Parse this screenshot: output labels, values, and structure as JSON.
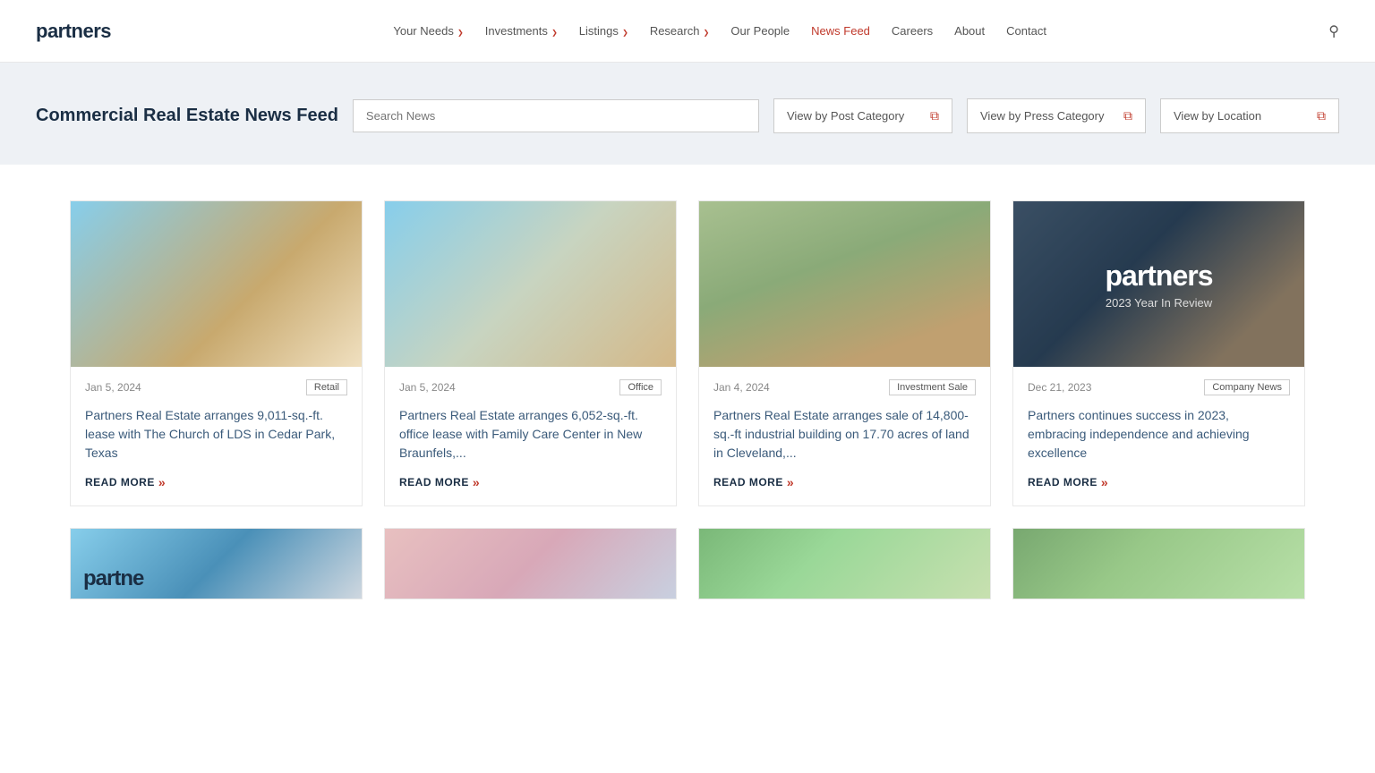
{
  "site": {
    "logo": "partners"
  },
  "nav": {
    "links": [
      {
        "label": "Your Needs",
        "hasChevron": true,
        "active": false
      },
      {
        "label": "Investments",
        "hasChevron": true,
        "active": false
      },
      {
        "label": "Listings",
        "hasChevron": true,
        "active": false
      },
      {
        "label": "Research",
        "hasChevron": true,
        "active": false
      },
      {
        "label": "Our People",
        "hasChevron": false,
        "active": false
      },
      {
        "label": "News Feed",
        "hasChevron": false,
        "active": true
      },
      {
        "label": "Careers",
        "hasChevron": false,
        "active": false
      },
      {
        "label": "About",
        "hasChevron": false,
        "active": false
      },
      {
        "label": "Contact",
        "hasChevron": false,
        "active": false
      }
    ]
  },
  "filterBar": {
    "title": "Commercial Real Estate News Feed",
    "searchPlaceholder": "Search News",
    "dropdowns": [
      {
        "label": "View by Post Category"
      },
      {
        "label": "View by Press Category"
      },
      {
        "label": "View by Location"
      }
    ]
  },
  "newsCards": [
    {
      "date": "Jan 5, 2024",
      "tag": "Retail",
      "title": "Partners Real Estate arranges 9,011-sq.-ft. lease with The Church of LDS in Cedar Park, Texas",
      "readMore": "READ MORE",
      "imgClass": "img-card1",
      "type": "photo"
    },
    {
      "date": "Jan 5, 2024",
      "tag": "Office",
      "title": "Partners Real Estate arranges 6,052-sq.-ft. office lease with Family Care Center in New Braunfels,...",
      "readMore": "READ MORE",
      "imgClass": "img-card2",
      "type": "photo"
    },
    {
      "date": "Jan 4, 2024",
      "tag": "Investment Sale",
      "title": "Partners Real Estate arranges sale of 14,800-sq.-ft industrial building on 17.70 acres of land in Cleveland,...",
      "readMore": "READ MORE",
      "imgClass": "img-card3",
      "type": "photo"
    },
    {
      "date": "Dec 21, 2023",
      "tag": "Company News",
      "title": "Partners continues success in 2023, embracing independence and achieving excellence",
      "readMore": "READ MORE",
      "imgClass": "img-card4",
      "type": "partners-overlay",
      "overlayLogo": "partners",
      "overlaySub": "2023 Year In Review"
    }
  ],
  "bottomCards": [
    {
      "imgClass": "img-card5",
      "type": "partners-overlay2",
      "overlayLogo": "partne"
    },
    {
      "imgClass": "img-card6",
      "type": "photo"
    },
    {
      "imgClass": "img-card7",
      "type": "photo"
    },
    {
      "imgClass": "img-card8",
      "type": "photo"
    }
  ],
  "colors": {
    "accent": "#c0392b",
    "brand": "#1a2e44"
  }
}
